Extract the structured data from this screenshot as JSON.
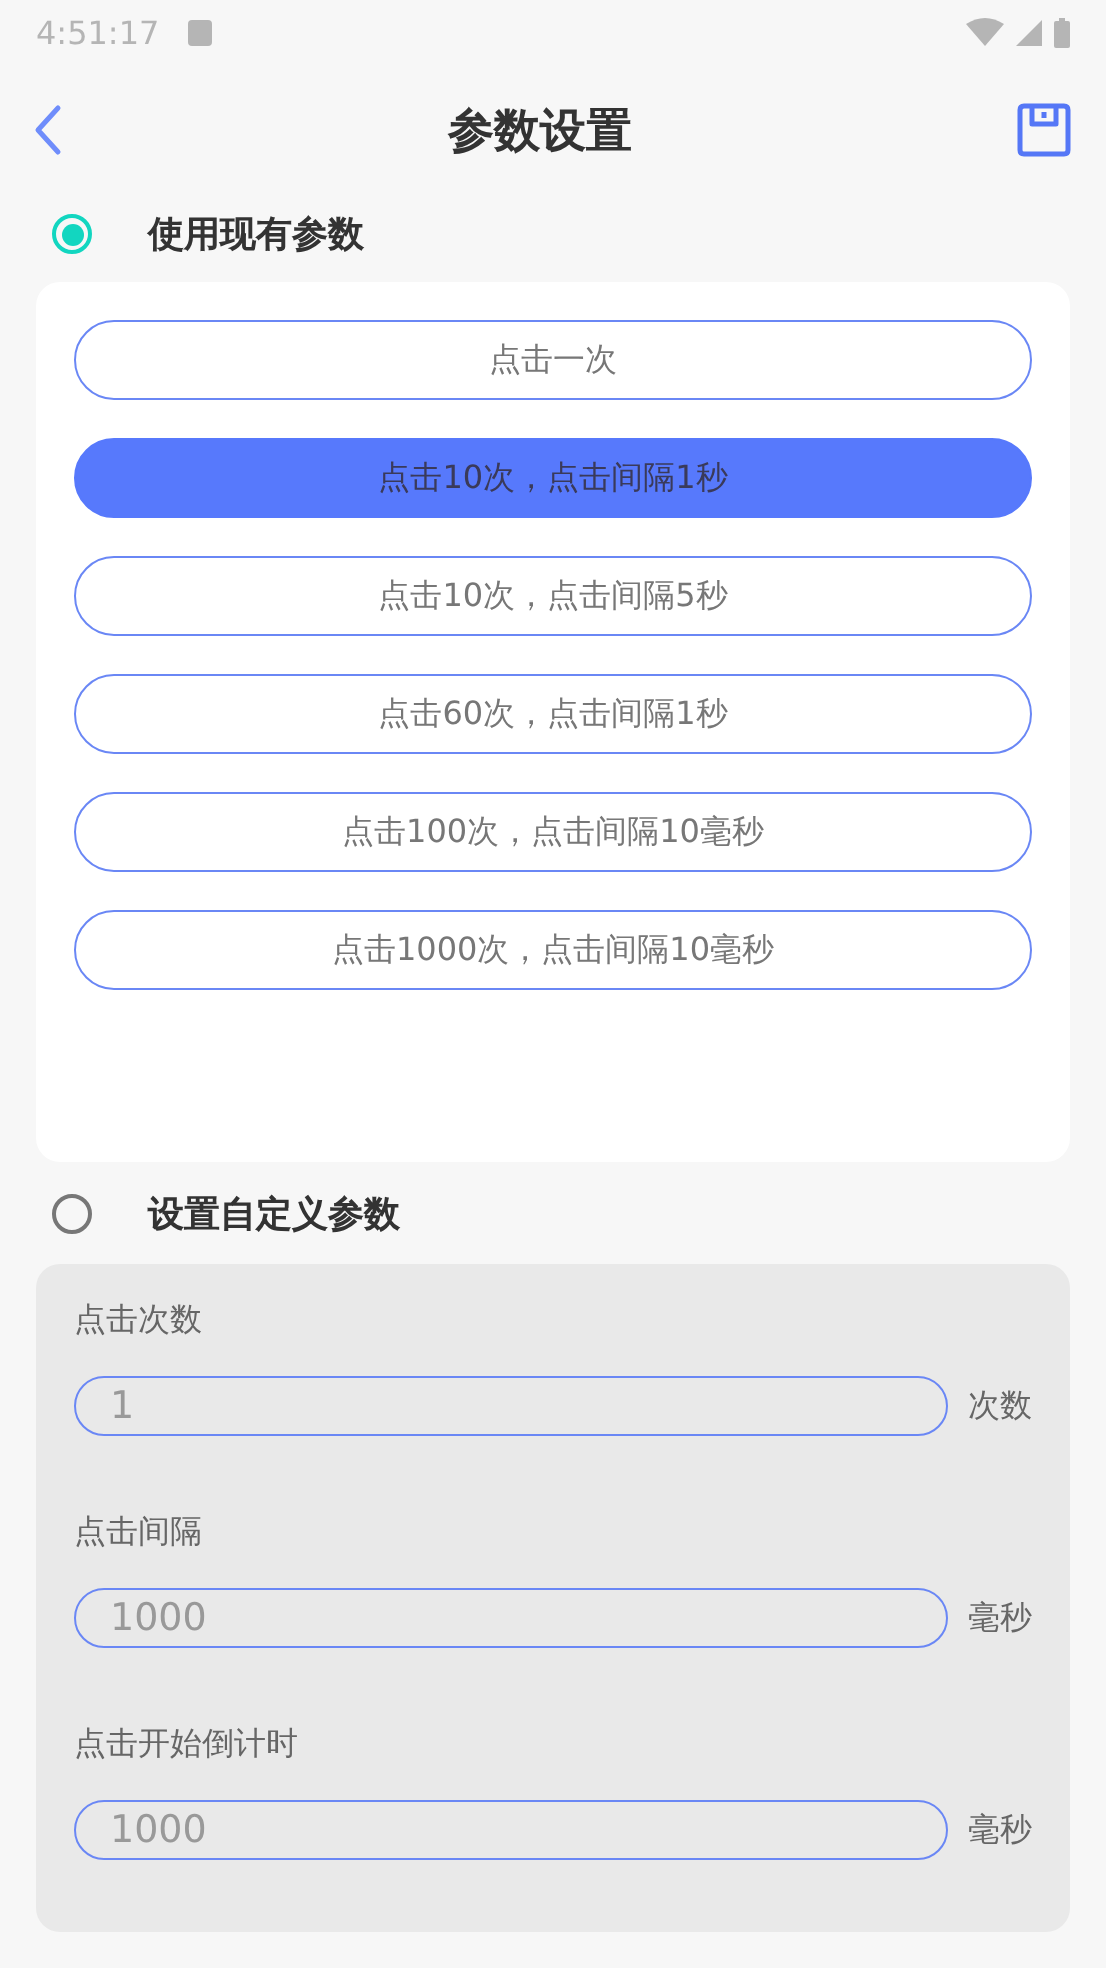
{
  "status_bar": {
    "time": "4:51:17"
  },
  "header": {
    "title": "参数设置"
  },
  "preset_section": {
    "label": "使用现有参数",
    "selected": true,
    "options": [
      {
        "label": "点击一次",
        "selected": false
      },
      {
        "label": "点击10次，点击间隔1秒",
        "selected": true
      },
      {
        "label": "点击10次，点击间隔5秒",
        "selected": false
      },
      {
        "label": "点击60次，点击间隔1秒",
        "selected": false
      },
      {
        "label": "点击100次，点击间隔10毫秒",
        "selected": false
      },
      {
        "label": "点击1000次，点击间隔10毫秒",
        "selected": false
      }
    ]
  },
  "custom_section": {
    "label": "设置自定义参数",
    "selected": false,
    "fields": [
      {
        "label": "点击次数",
        "placeholder": "1",
        "unit": "次数"
      },
      {
        "label": "点击间隔",
        "placeholder": "1000",
        "unit": "毫秒"
      },
      {
        "label": "点击开始倒计时",
        "placeholder": "1000",
        "unit": "毫秒"
      }
    ]
  }
}
